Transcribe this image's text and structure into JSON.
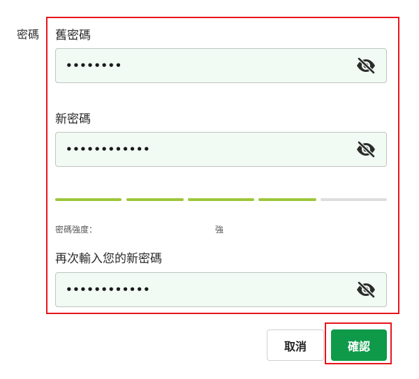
{
  "section_label": "密碼",
  "old_password": {
    "label": "舊密碼",
    "value": "••••••••"
  },
  "new_password": {
    "label": "新密碼",
    "value": "••••••••••••"
  },
  "strength": {
    "label": "密碼強度：",
    "value_label": "強",
    "filled_segments": 4,
    "total_segments": 5,
    "filled_color": "#9dc63b",
    "empty_color": "#dddddd"
  },
  "confirm_password": {
    "label": "再次輸入您的新密碼",
    "value": "••••••••••••"
  },
  "actions": {
    "cancel_label": "取消",
    "confirm_label": "確認"
  },
  "icons": {
    "visibility_toggle": "eye-slash-icon"
  },
  "colors": {
    "primary": "#0f9a4a",
    "highlight": "#e8141c",
    "input_bg": "#f1faf3"
  }
}
